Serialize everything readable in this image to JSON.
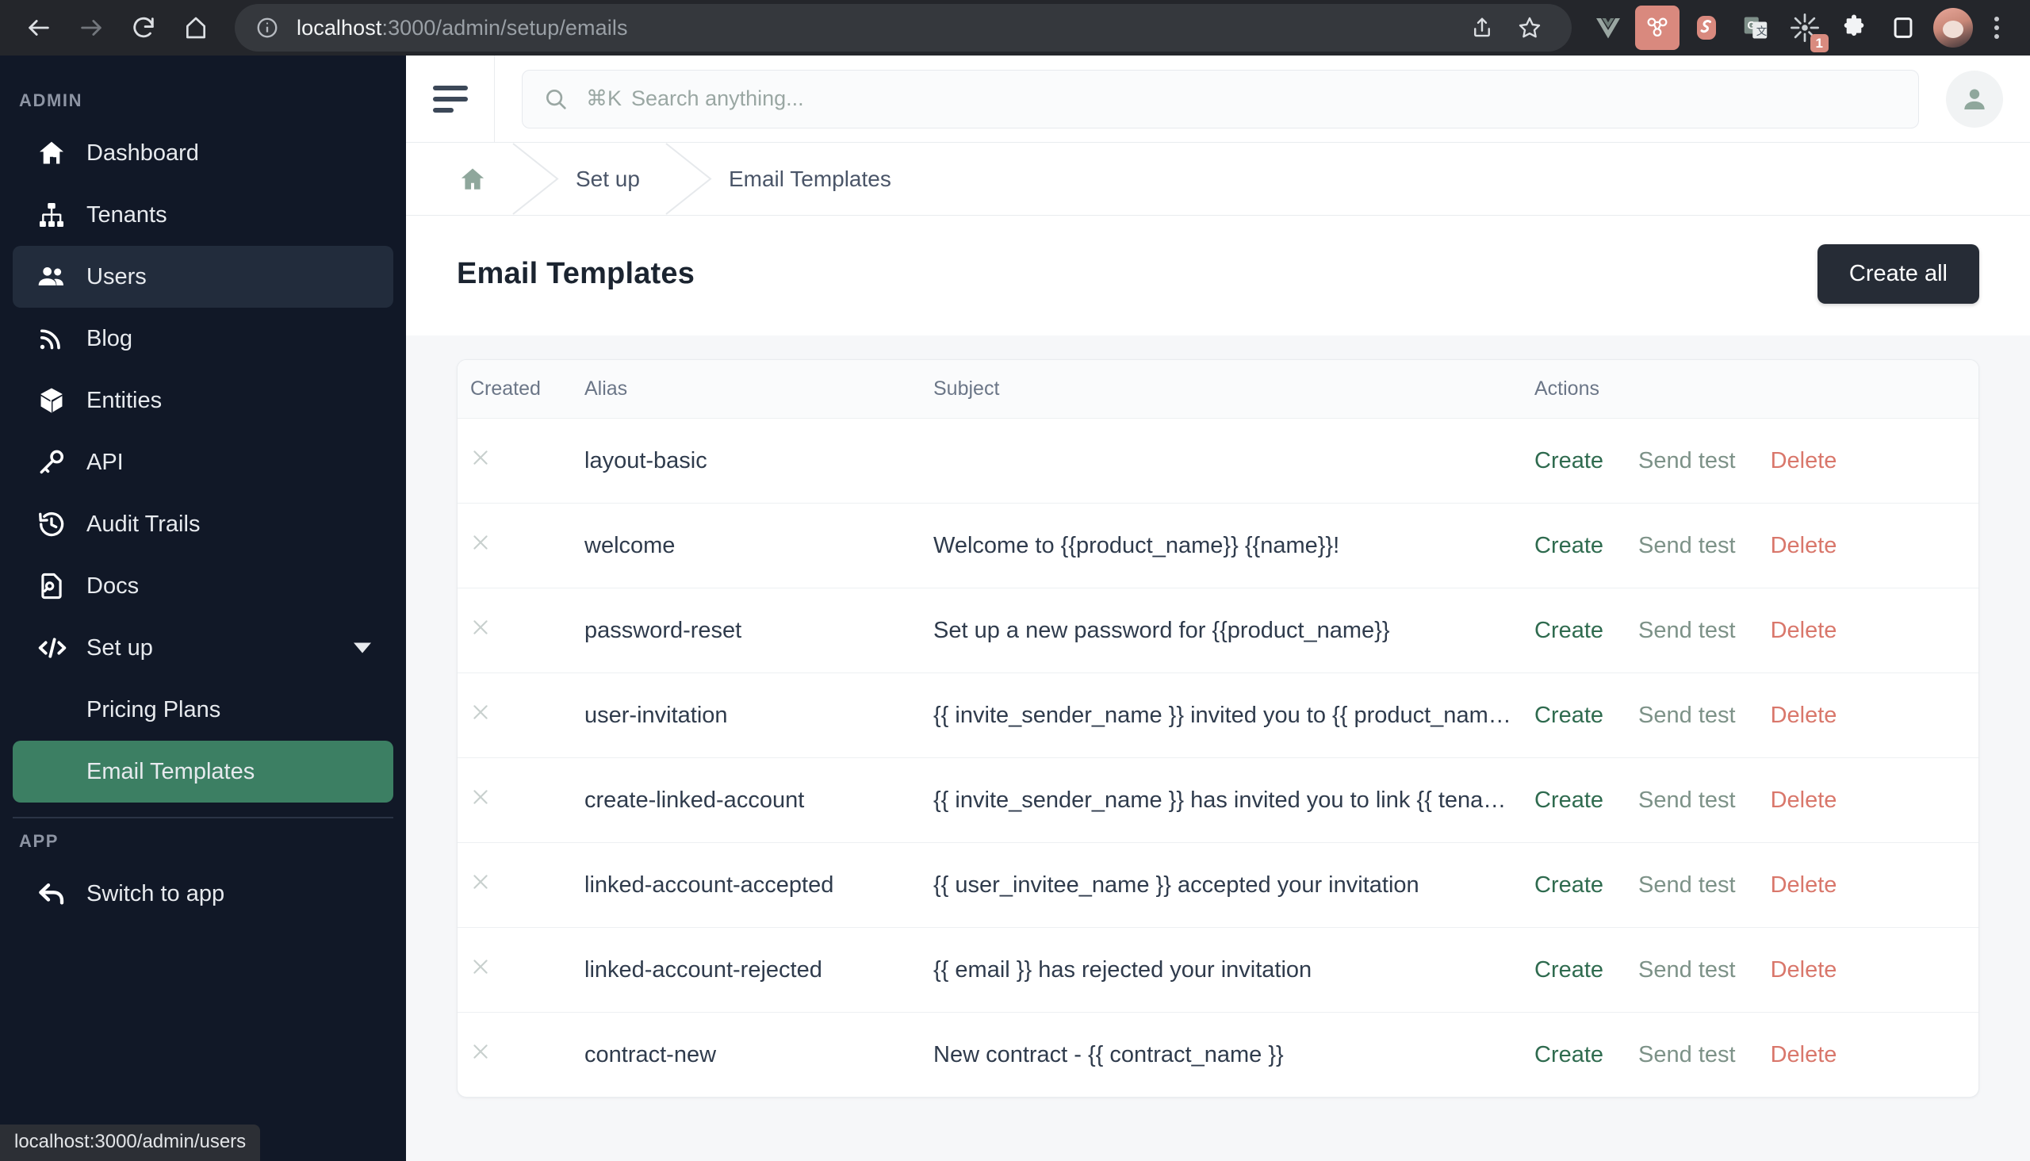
{
  "browser": {
    "back_label": "Back",
    "forward_label": "Forward",
    "reload_label": "Reload",
    "home_label": "Home",
    "url_host": "localhost",
    "url_path": ":3000/admin/setup/emails",
    "share_label": "Share",
    "bookmark_label": "Bookmark this tab",
    "extensions": [
      {
        "name": "vue-devtools-icon",
        "badge": ""
      },
      {
        "name": "molecule-extension-icon",
        "badge": ""
      },
      {
        "name": "svelte-devtools-icon",
        "badge": ""
      },
      {
        "name": "google-translate-icon",
        "badge": ""
      },
      {
        "name": "sunburst-extension-icon",
        "badge": "1"
      },
      {
        "name": "puzzle-extensions-icon",
        "badge": ""
      },
      {
        "name": "side-panel-icon",
        "badge": ""
      }
    ],
    "profile_label": "Profile",
    "menu_label": "Customize and control Chromium"
  },
  "status_bar": {
    "url": "localhost:3000/admin/users"
  },
  "sidebar": {
    "section_admin": "ADMIN",
    "section_app": "APP",
    "items": [
      {
        "label": "Dashboard",
        "icon": "home-icon",
        "state": "default"
      },
      {
        "label": "Tenants",
        "icon": "sitemap-icon",
        "state": "default"
      },
      {
        "label": "Users",
        "icon": "users-icon",
        "state": "active"
      },
      {
        "label": "Blog",
        "icon": "rss-icon",
        "state": "default"
      },
      {
        "label": "Entities",
        "icon": "cube-icon",
        "state": "default"
      },
      {
        "label": "API",
        "icon": "key-icon",
        "state": "default"
      },
      {
        "label": "Audit Trails",
        "icon": "history-icon",
        "state": "default"
      },
      {
        "label": "Docs",
        "icon": "document-search-icon",
        "state": "default"
      },
      {
        "label": "Set up",
        "icon": "code-icon",
        "state": "expandable"
      },
      {
        "label": "Pricing Plans",
        "icon": "none",
        "state": "sub"
      },
      {
        "label": "Email Templates",
        "icon": "none",
        "state": "sub-selected"
      }
    ],
    "app_items": [
      {
        "label": "Switch to app",
        "icon": "arrow-back-icon"
      }
    ],
    "colors": {
      "background": "#111827",
      "active": "#222c3c",
      "selected": "#3c7f63"
    }
  },
  "topbar": {
    "menu_toggle_label": "Toggle sidebar",
    "search_shortcut": "⌘K",
    "search_placeholder": "Search anything...",
    "search_value": "",
    "account_label": "Account"
  },
  "breadcrumb": {
    "home_label": "Home",
    "items": [
      "Set up",
      "Email Templates"
    ]
  },
  "page": {
    "title": "Email Templates",
    "primary_action": "Create all"
  },
  "table": {
    "columns": [
      "Created",
      "Alias",
      "Subject",
      "Actions"
    ],
    "created_marker": "✕",
    "actions": {
      "create": "Create",
      "send_test": "Send test",
      "delete": "Delete"
    },
    "rows": [
      {
        "created": false,
        "alias": "layout-basic",
        "subject": ""
      },
      {
        "created": false,
        "alias": "welcome",
        "subject": "Welcome to {{product_name}} {{name}}!"
      },
      {
        "created": false,
        "alias": "password-reset",
        "subject": "Set up a new password for {{product_name}}"
      },
      {
        "created": false,
        "alias": "user-invitation",
        "subject": "{{ invite_sender_name }} invited you to {{ product_name }}"
      },
      {
        "created": false,
        "alias": "create-linked-account",
        "subject": "{{ invite_sender_name }} has invited you to link {{ tenant_name }}"
      },
      {
        "created": false,
        "alias": "linked-account-accepted",
        "subject": "{{ user_invitee_name }} accepted your invitation"
      },
      {
        "created": false,
        "alias": "linked-account-rejected",
        "subject": "{{ email }} has rejected your invitation"
      },
      {
        "created": false,
        "alias": "contract-new",
        "subject": "New contract - {{ contract_name }}"
      }
    ]
  },
  "colors": {
    "accent_green": "#3c7f63",
    "action_create": "#2f6b4f",
    "action_send": "#7d9288",
    "action_delete": "#d9776b",
    "dark_button": "#262c36",
    "page_background": "#f6f7f9"
  }
}
